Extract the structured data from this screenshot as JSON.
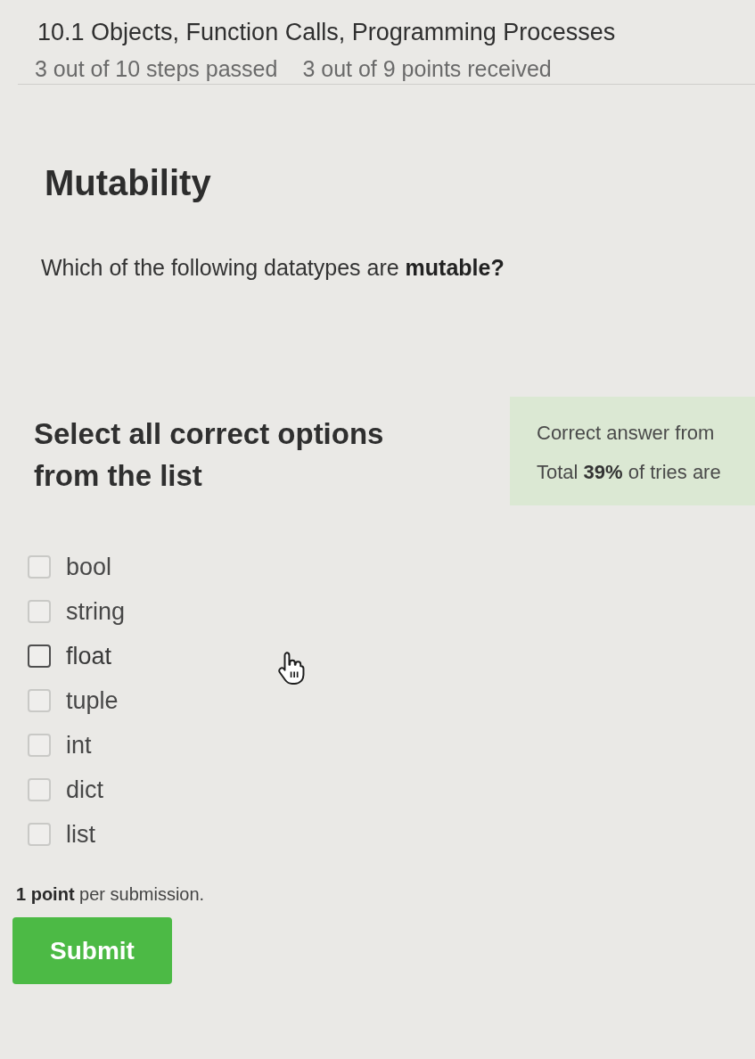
{
  "header": {
    "title": "10.1 Objects, Function Calls, Programming Processes",
    "steps_progress": "3 out of 10 steps passed",
    "points_progress": "3 out of 9 points received"
  },
  "step": {
    "title": "Mutability",
    "question": "Which of the following datatypes are **mutable?**"
  },
  "quiz": {
    "prompt": "Select all correct options from the list",
    "options": [
      {
        "label": "bool",
        "checked": false,
        "hovered": false
      },
      {
        "label": "string",
        "checked": false,
        "hovered": false
      },
      {
        "label": "float",
        "checked": false,
        "hovered": true
      },
      {
        "label": "tuple",
        "checked": false,
        "hovered": false
      },
      {
        "label": "int",
        "checked": false,
        "hovered": false
      },
      {
        "label": "dict",
        "checked": false,
        "hovered": false
      },
      {
        "label": "list",
        "checked": false,
        "hovered": false
      }
    ],
    "stats": [
      "Correct answer from",
      "Total **39%** of tries are"
    ],
    "note": "**1 point** per submission.",
    "submit_label": "Submit"
  }
}
